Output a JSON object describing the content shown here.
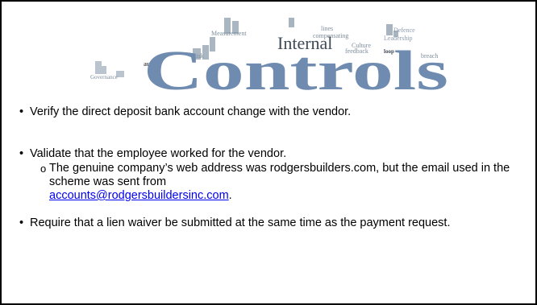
{
  "banner": {
    "title_big": "Controls",
    "title_medium": "Internal",
    "words": [
      "Measurement",
      "lines",
      "compensating",
      "Defence",
      "Leadership",
      "Risk",
      "Culture",
      "feedback",
      "loop",
      "breach",
      "audit",
      "Governance"
    ],
    "colors": {
      "title": "#6f8cb0",
      "words": "#7d8d9c"
    }
  },
  "bullets": [
    {
      "marker": "•",
      "text": "Verify the direct deposit bank account change with the vendor."
    },
    {
      "marker": "•",
      "text": "Validate that the employee worked for the vendor.",
      "sub": {
        "marker": "o",
        "text": "The genuine company’s web address was rodgersbuilders.com, but the email used in the scheme was sent from",
        "link": "accounts@rodgersbuildersinc.com",
        "after_link": "."
      }
    },
    {
      "marker": "•",
      "text": "Require that a lien waiver be submitted at the same time as the payment request."
    }
  ]
}
